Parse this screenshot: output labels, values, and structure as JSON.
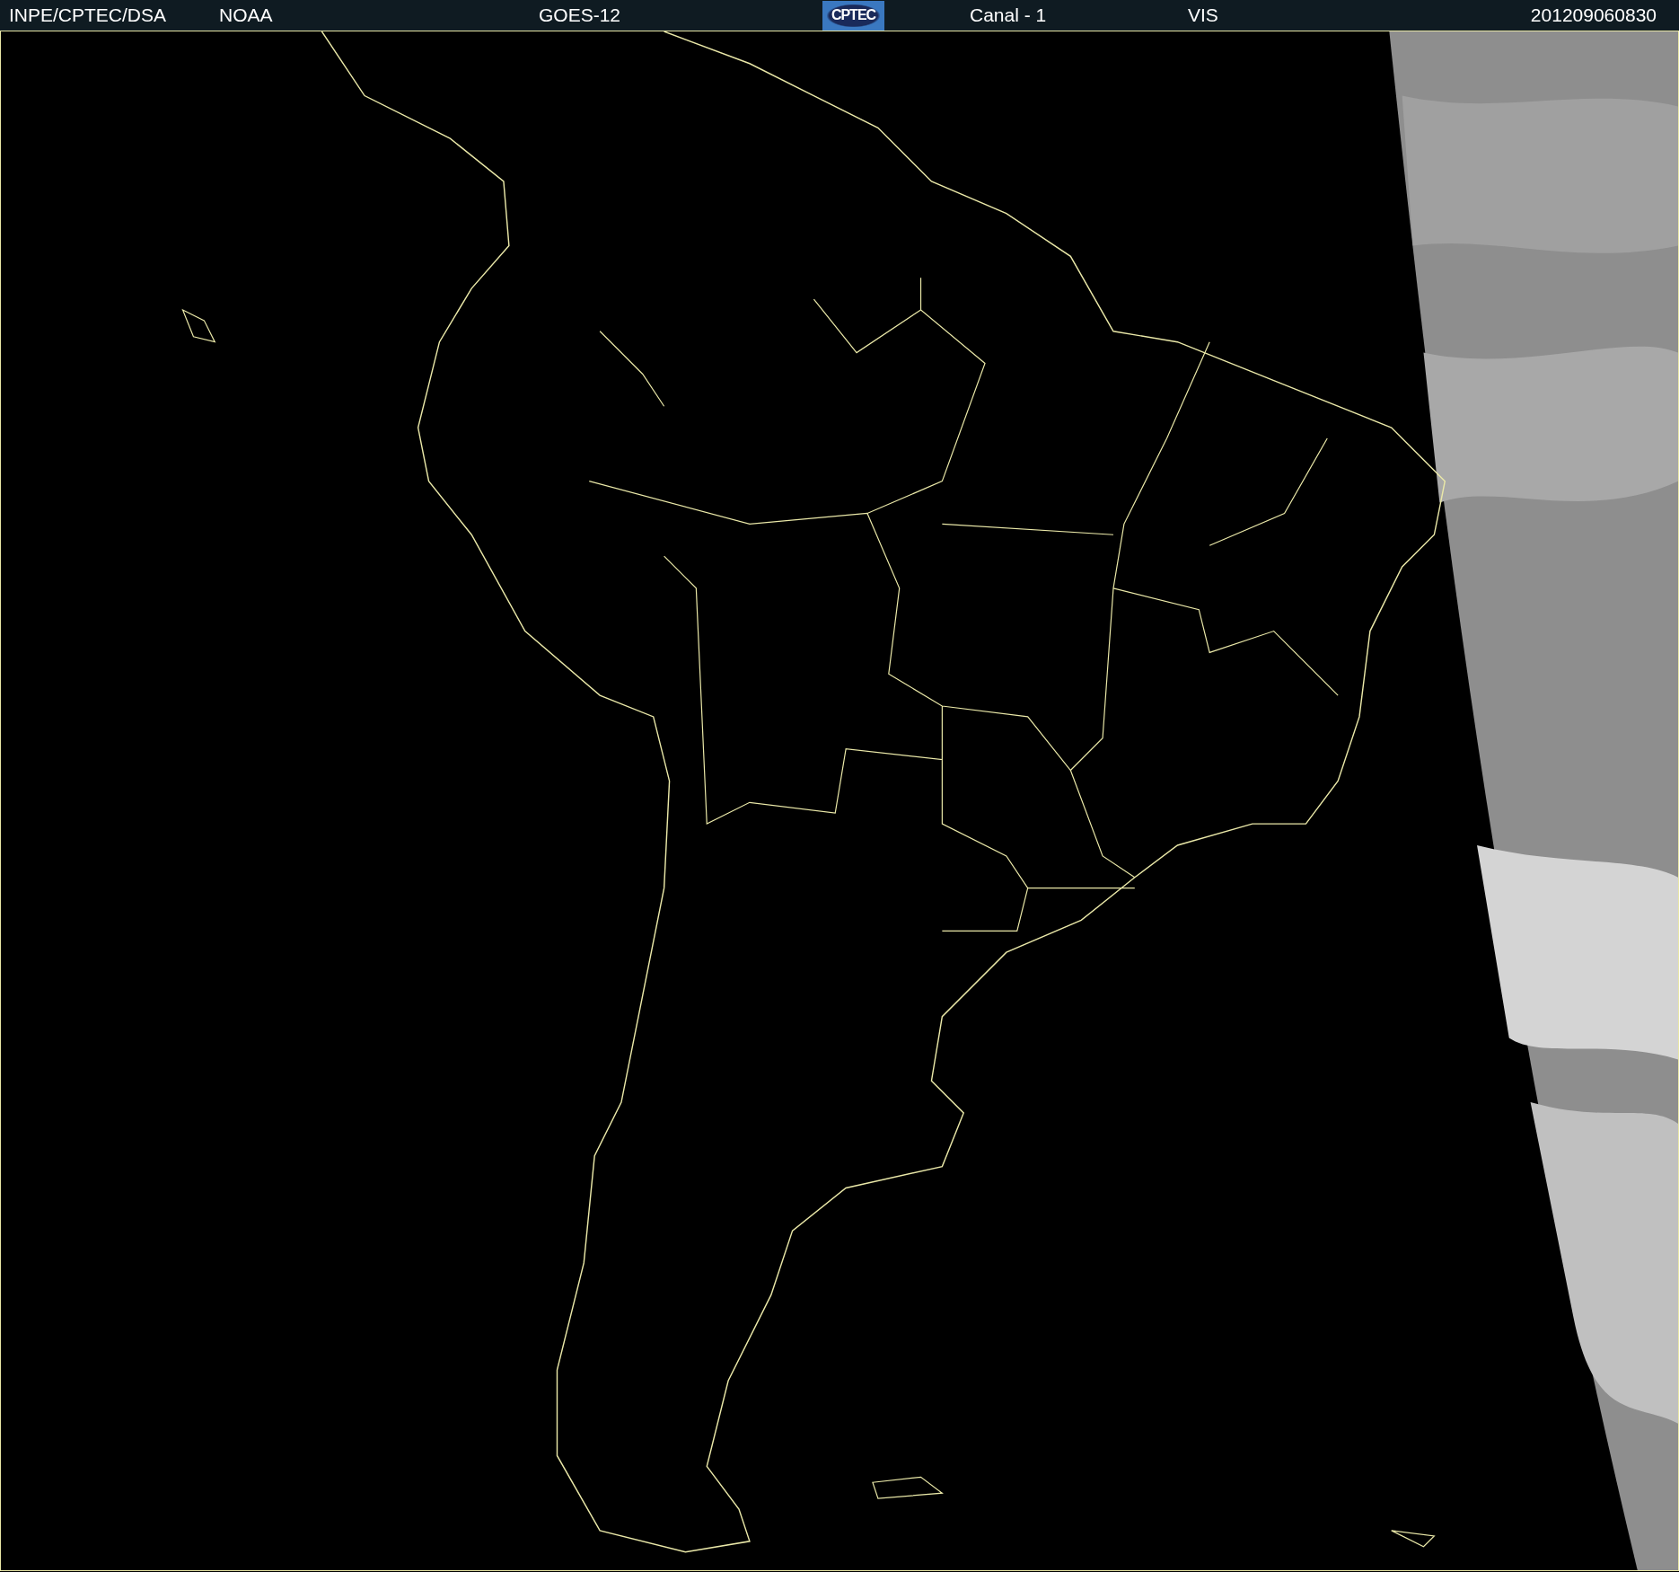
{
  "header": {
    "source": "INPE/CPTEC/DSA",
    "agency": "NOAA",
    "satellite": "GOES-12",
    "logo": "CPTEC",
    "channel": "Canal - 1",
    "band": "VIS",
    "timestamp": "201209060830"
  }
}
